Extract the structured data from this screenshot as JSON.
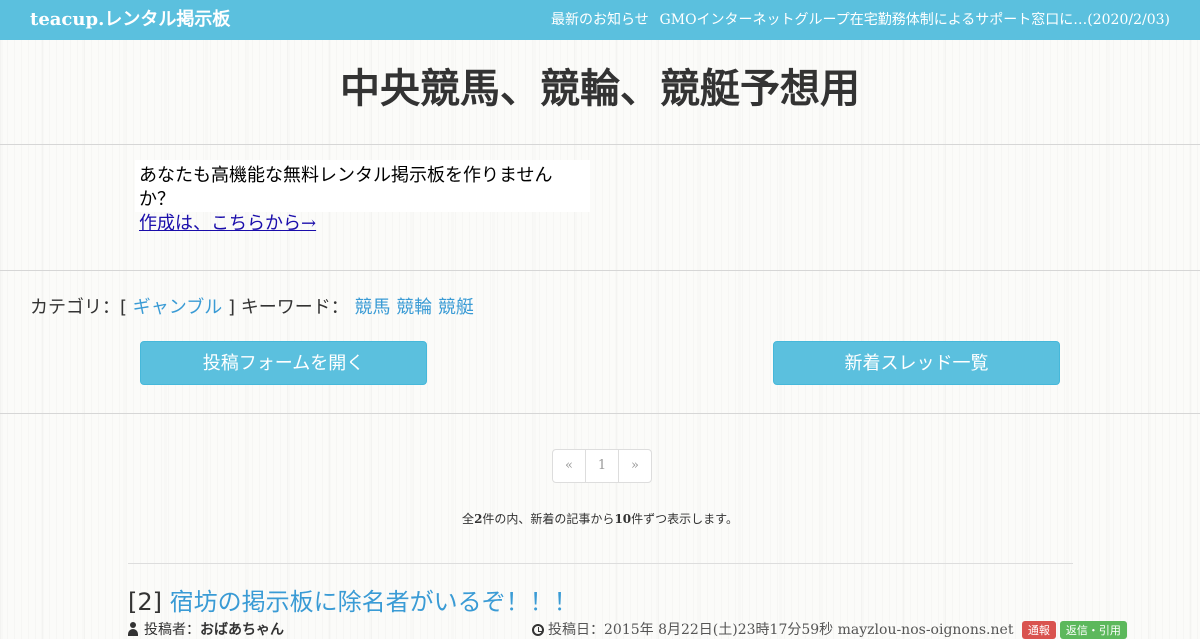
{
  "header": {
    "brand": "teacup.レンタル掲示板",
    "news_label": "最新のお知らせ",
    "notice": "GMOインターネットグループ在宅勤務体制によるサポート窓口に…(2020/2/03)"
  },
  "board": {
    "title": "中央競馬、競輪、競艇予想用"
  },
  "promo": {
    "text": "あなたも高機能な無料レンタル掲示板を作りませんか？",
    "link": "作成は、こちらから→"
  },
  "category": {
    "label_prefix": "カテゴリ：[",
    "category_link": "ギャンブル",
    "label_suffix": "] キーワード：",
    "keywords": [
      "競馬",
      "競輪",
      "競艇"
    ]
  },
  "buttons": {
    "open_form": "投稿フォームを開く",
    "new_threads": "新着スレッド一覧"
  },
  "pagination": {
    "prev": "«",
    "current": "1",
    "next": "»"
  },
  "summary": {
    "prefix": "全",
    "total": "2",
    "middle": "件の内、新着の記事から",
    "per_page": "10",
    "suffix": "件ずつ表示します。"
  },
  "post": {
    "number": "[2]",
    "title": "宿坊の掲示板に除名者がいるぞ！！！",
    "author_label": "投稿者：",
    "author": "おばあちゃん",
    "date_label": "投稿日：",
    "date": "2015年 8月22日(土)23時17分59秒",
    "host": "mayzlou-nos-oignons.net",
    "badge_report": "通報",
    "badge_reply": "返信・引用"
  },
  "colors": {
    "accent": "#5bc0de",
    "link": "#3a9bd5",
    "report": "#d9534f",
    "reply": "#5cb85c"
  }
}
